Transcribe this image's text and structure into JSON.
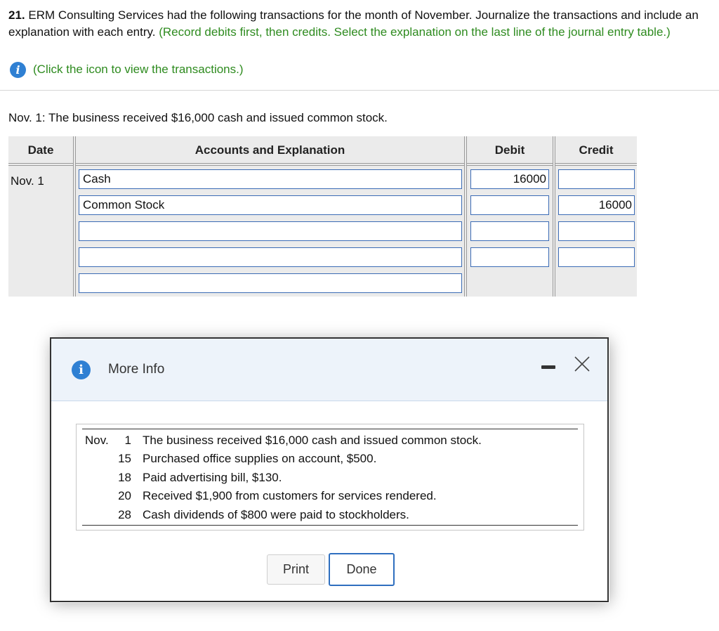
{
  "question": {
    "number": "21.",
    "text": "ERM Consulting Services had the following transactions for the month of November. Journalize the transactions and include an explanation with each entry.",
    "instruction": "(Record debits first, then credits. Select the explanation on the last line of the journal entry table.)",
    "info_link": "(Click the icon to view the transactions.)"
  },
  "prompt": "Nov. 1: The business received $16,000 cash and issued common stock.",
  "journal": {
    "headers": {
      "date": "Date",
      "accounts": "Accounts and Explanation",
      "debit": "Debit",
      "credit": "Credit"
    },
    "date": "Nov. 1",
    "rows": [
      {
        "account": "Cash",
        "debit": "16000",
        "credit": ""
      },
      {
        "account": "Common Stock",
        "debit": "",
        "credit": "16000"
      },
      {
        "account": "",
        "debit": "",
        "credit": ""
      },
      {
        "account": "",
        "debit": "",
        "credit": ""
      }
    ],
    "explanation": ""
  },
  "dialog": {
    "title": "More Info",
    "month": "Nov.",
    "transactions": [
      {
        "day": "1",
        "text": "The business received $16,000 cash and issued common stock."
      },
      {
        "day": "15",
        "text": "Purchased office supplies on account, $500."
      },
      {
        "day": "18",
        "text": "Paid advertising bill, $130."
      },
      {
        "day": "20",
        "text": "Received $1,900 from customers for services rendered."
      },
      {
        "day": "28",
        "text": "Cash dividends of $800 were paid to stockholders."
      }
    ],
    "print_label": "Print",
    "done_label": "Done",
    "icons": {
      "info": "info-icon",
      "minimize": "minimize-icon",
      "close": "close-icon"
    }
  },
  "colors": {
    "green": "#2e8b1f",
    "info_blue": "#2f80d3",
    "field_border": "#3b6bb5",
    "table_bg": "#ebebeb"
  }
}
